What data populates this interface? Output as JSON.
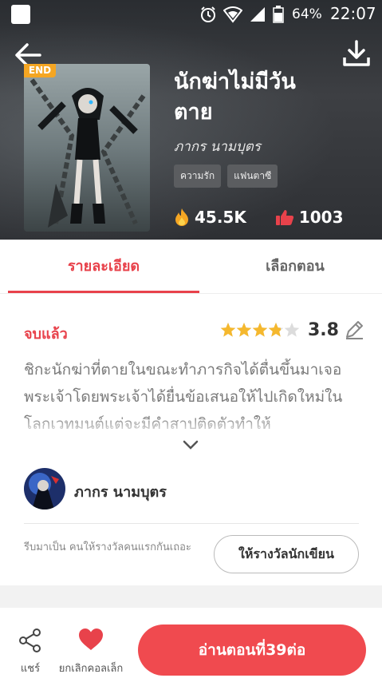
{
  "status_bar": {
    "battery": "64%",
    "time": "22:07"
  },
  "book": {
    "end_badge": "END",
    "title": "นักฆ่าไม่มีวันตาย",
    "author": "ภากร นามบุตร",
    "tags": [
      "ความรัก",
      "แฟนตาซี"
    ],
    "views": "45.5K",
    "likes": "1003"
  },
  "tabs": {
    "detail": "รายละเอียด",
    "chapters": "เลือกตอน"
  },
  "detail": {
    "status": "จบแล้ว",
    "rating": "3.8",
    "rating_stars": 3.8,
    "synopsis": "ชิกะนักฆ่าที่ตายในขณะทำภารกิจได้ตื่นขึ้นมาเจอพระเจ้าโดยพระเจ้าได้ยื่นข้อเสนอให้ไปเกิดใหม่ในโลกเวทมนต์แต่จะมีคำสาปติดตัวทำให้"
  },
  "author_section": {
    "name": "ภากร นามบุตร",
    "reward_text": "รีบมาเป็น คนให้รางวัลคนแรกกันเถอะ",
    "reward_button": "ให้รางวัลนักเขียน"
  },
  "bottom_bar": {
    "share": "แชร์",
    "favorite": "ยกเลิกคอลเล็ก",
    "read": "อ่านตอนที่39ต่อ"
  },
  "colors": {
    "accent": "#e8424b",
    "read_button": "#f04a4f",
    "badge": "#f5a623",
    "star": "#f5b82e"
  }
}
